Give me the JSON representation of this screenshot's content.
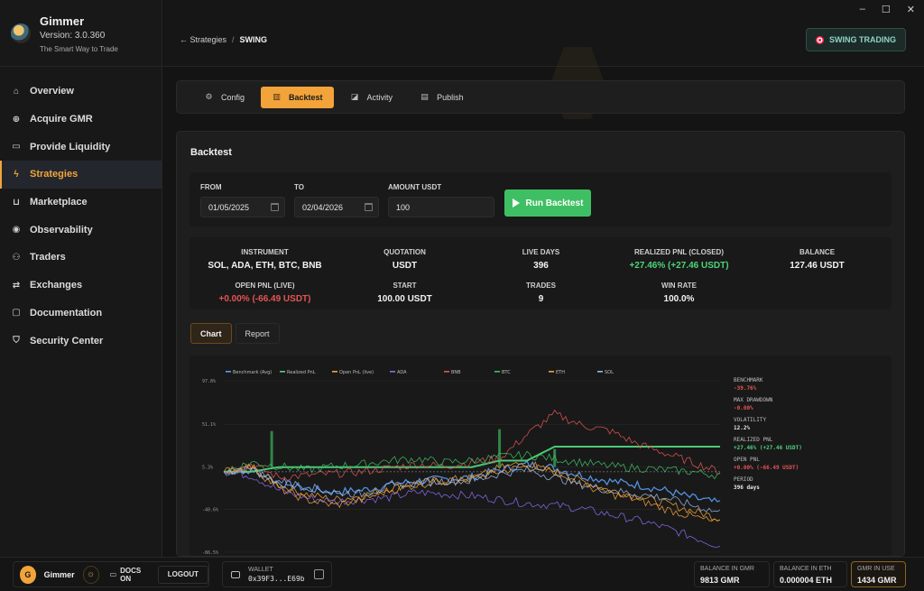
{
  "app": {
    "name": "Gimmer",
    "version": "Version: 3.0.360",
    "tagline": "The Smart Way to Trade"
  },
  "window_controls": [
    "–",
    "☐",
    "✕"
  ],
  "sidebar": {
    "items": [
      {
        "label": "Overview",
        "icon": "home-icon"
      },
      {
        "label": "Acquire GMR",
        "icon": "plus-circle-icon"
      },
      {
        "label": "Provide Liquidity",
        "icon": "card-icon"
      },
      {
        "label": "Strategies",
        "icon": "bolt-icon",
        "active": true
      },
      {
        "label": "Marketplace",
        "icon": "cart-icon"
      },
      {
        "label": "Observability",
        "icon": "eye-icon"
      },
      {
        "label": "Traders",
        "icon": "users-icon"
      },
      {
        "label": "Exchanges",
        "icon": "swap-icon"
      },
      {
        "label": "Documentation",
        "icon": "doc-icon"
      },
      {
        "label": "Security Center",
        "icon": "shield-icon"
      }
    ]
  },
  "header": {
    "back_label": "← Strategies",
    "separator": "/",
    "current": "SWING",
    "mode_button": "SWING TRADING"
  },
  "tabs": [
    {
      "label": "Config",
      "icon": "gear-icon"
    },
    {
      "label": "Backtest",
      "icon": "bar-chart-icon",
      "active": true
    },
    {
      "label": "Activity",
      "icon": "activity-icon"
    },
    {
      "label": "Publish",
      "icon": "publish-icon"
    }
  ],
  "backtest": {
    "title": "Backtest",
    "from_label": "FROM",
    "from_value": "01/05/2025",
    "to_label": "TO",
    "to_value": "02/04/2026",
    "amount_label": "AMOUNT USDT",
    "amount_value": "100",
    "run_label": "Run Backtest"
  },
  "stats": [
    {
      "label": "INSTRUMENT",
      "value": "SOL, ADA, ETH, BTC, BNB"
    },
    {
      "label": "QUOTATION",
      "value": "USDT"
    },
    {
      "label": "LIVE DAYS",
      "value": "396"
    },
    {
      "label": "REALIZED PNL (CLOSED)",
      "value": "+27.46% (+27.46 USDT)",
      "tone": "pos"
    },
    {
      "label": "BALANCE",
      "value": "127.46 USDT"
    },
    {
      "label": "OPEN PNL (LIVE)",
      "value": "+0.00% (-66.49 USDT)",
      "tone": "neg"
    },
    {
      "label": "START",
      "value": "100.00 USDT"
    },
    {
      "label": "TRADES",
      "value": "9"
    },
    {
      "label": "WIN RATE",
      "value": "100.0%"
    }
  ],
  "chart_tabs": [
    {
      "label": "Chart",
      "active": true
    },
    {
      "label": "Report"
    }
  ],
  "metrics": [
    {
      "label": "BENCHMARK",
      "value": "-39.76%",
      "tone": "neg"
    },
    {
      "label": "MAX DRAWDOWN",
      "value": "-0.00%",
      "tone": "neg"
    },
    {
      "label": "VOLATILITY",
      "value": "12.2%"
    },
    {
      "label": "REALIZED PNL",
      "value": "+27.46% (+27.46 USDT)",
      "tone": "pos"
    },
    {
      "label": "OPEN PNL",
      "value": "+0.00% (-66.49 USDT)",
      "tone": "neg"
    },
    {
      "label": "PERIOD",
      "value": "396 days"
    }
  ],
  "chart_data": {
    "type": "line",
    "y_ticks": [
      "97.8%",
      "51.1%",
      "5.3%",
      "-40.6%",
      "-86.5%"
    ],
    "ylim": [
      -86.5,
      97.8
    ],
    "series": [
      {
        "name": "Benchmark (Avg)",
        "color": "#5b9cf5",
        "values": [
          0,
          3,
          -12,
          -18,
          -22,
          -20,
          -14,
          -10,
          -8,
          -6,
          2,
          8,
          4,
          -4,
          -10,
          -14,
          -20,
          -28,
          -34
        ]
      },
      {
        "name": "Realized PnL",
        "color": "#4cd47a",
        "values": [
          0,
          0,
          5,
          5,
          5,
          5,
          5,
          5,
          5,
          5,
          12,
          12,
          27,
          27,
          27,
          27,
          27,
          27,
          27
        ]
      },
      {
        "name": "Open PnL (live)",
        "color": "#f2a33a",
        "values": [
          0,
          4,
          -14,
          -24,
          -30,
          -26,
          -18,
          -12,
          -9,
          -7,
          0,
          6,
          0,
          -10,
          -20,
          -26,
          -34,
          -42,
          -50
        ]
      },
      {
        "name": "ADA",
        "color": "#8a6cf0",
        "values": [
          0,
          -4,
          -20,
          -28,
          -32,
          -30,
          -28,
          -22,
          -24,
          -26,
          -30,
          -34,
          -36,
          -40,
          -46,
          -52,
          -60,
          -70,
          -80
        ]
      },
      {
        "name": "BNB",
        "color": "#e45454",
        "values": [
          0,
          8,
          -6,
          -4,
          -2,
          0,
          4,
          8,
          6,
          10,
          14,
          40,
          62,
          50,
          44,
          30,
          20,
          10,
          0
        ]
      },
      {
        "name": "BTC",
        "color": "#3fbf63",
        "values": [
          0,
          10,
          6,
          2,
          6,
          8,
          12,
          14,
          10,
          12,
          16,
          18,
          14,
          10,
          6,
          4,
          2,
          0,
          -4
        ]
      },
      {
        "name": "ETH",
        "color": "#f2a33a",
        "values": [
          0,
          6,
          -18,
          -30,
          -36,
          -30,
          -20,
          -14,
          -10,
          -8,
          4,
          10,
          0,
          -14,
          -24,
          -30,
          -40,
          -48,
          -56
        ]
      },
      {
        "name": "SOL",
        "color": "#9ab8e8",
        "values": [
          0,
          2,
          -10,
          -16,
          -22,
          -24,
          -16,
          -12,
          -10,
          -10,
          -2,
          2,
          -6,
          -14,
          -20,
          -24,
          -28,
          -36,
          -44
        ]
      }
    ]
  },
  "footer": {
    "avatar_letter": "G",
    "username": "Gimmer",
    "docs_label": "DOCS ON",
    "logout_label": "LOGOUT",
    "wallet_label": "WALLET",
    "wallet_address": "0x39F3...E69b",
    "balances": [
      {
        "label": "BALANCE IN GMR",
        "value": "9813 GMR"
      },
      {
        "label": "BALANCE IN ETH",
        "value": "0.000004 ETH"
      },
      {
        "label": "GMR IN USE",
        "value": "1434 GMR",
        "highlight": true
      }
    ]
  }
}
